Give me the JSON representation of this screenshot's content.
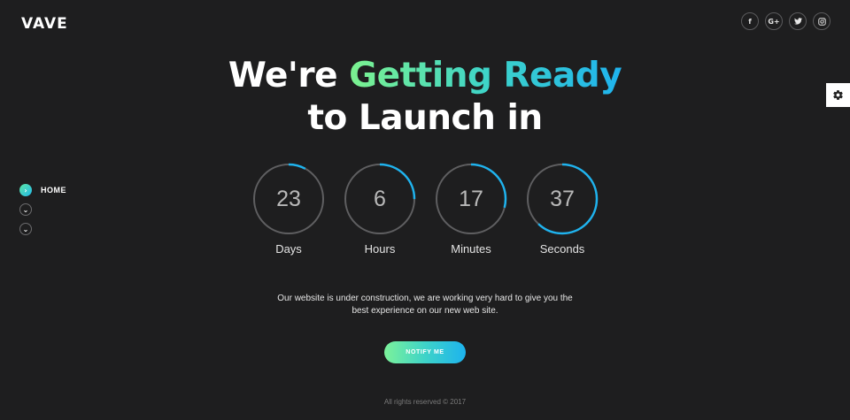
{
  "brand": {
    "logo": "VAVE"
  },
  "social_links": [
    {
      "name": "facebook",
      "glyph": "f"
    },
    {
      "name": "google-plus",
      "glyph": "G+"
    },
    {
      "name": "twitter",
      "glyph": "t"
    },
    {
      "name": "instagram",
      "glyph": "◻"
    }
  ],
  "settings": {
    "icon": "gear-icon"
  },
  "sidenav": {
    "items": [
      {
        "label": "HOME",
        "icon": "chevron-right-icon",
        "active": true
      },
      {
        "label": "",
        "icon": "chevron-down-icon",
        "active": false
      },
      {
        "label": "",
        "icon": "chevron-down-icon",
        "active": false
      }
    ]
  },
  "hero": {
    "line1_plain": "We're ",
    "line1_highlight": "Getting Ready",
    "line2": "to Launch in"
  },
  "countdown": [
    {
      "value": "23",
      "label": "Days",
      "progress": 0.08
    },
    {
      "value": "6",
      "label": "Hours",
      "progress": 0.25
    },
    {
      "value": "17",
      "label": "Minutes",
      "progress": 0.29
    },
    {
      "value": "37",
      "label": "Seconds",
      "progress": 0.62
    }
  ],
  "description": {
    "line1": "Our website is under construction, we are working very hard to give you the",
    "line2": "best experience on our new web site."
  },
  "cta": {
    "label": "NOTIFY ME"
  },
  "footer": {
    "text": "All rights reserved © 2017"
  },
  "colors": {
    "background": "#1e1e1f",
    "ring_track": "#5f5f61",
    "ring_progress": "#1fb3ee",
    "gradient_start": "#7cf28f",
    "gradient_end": "#1fb3ee"
  }
}
